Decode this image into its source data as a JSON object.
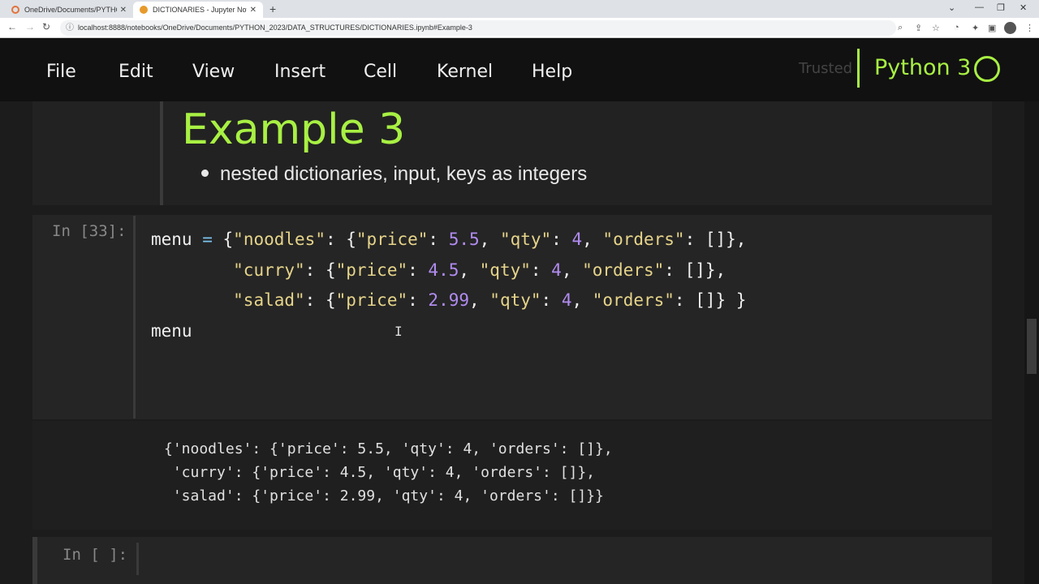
{
  "browser": {
    "tabs": [
      {
        "title": "OneDrive/Documents/PYTHON_",
        "active": false,
        "favicon_color": "#e2733a"
      },
      {
        "title": "DICTIONARIES - Jupyter Notebo",
        "active": true,
        "favicon_color": "#e79a2b"
      }
    ],
    "new_tab": "+",
    "url": "localhost:8888/notebooks/OneDrive/Documents/PYTHON_2023/DATA_STRUCTURES/DICTIONARIES.ipynb#Example-3"
  },
  "jupyter": {
    "menu": [
      "File",
      "Edit",
      "View",
      "Insert",
      "Cell",
      "Kernel",
      "Help"
    ],
    "trusted": "Trusted",
    "kernel": "Python 3",
    "accent": "#a8f043"
  },
  "markdown": {
    "heading": "Example 3",
    "bullet": "nested dictionaries, input, keys as integers"
  },
  "code_cell": {
    "prompt": "In [33]:",
    "line1": {
      "a": "menu ",
      "eq": "=",
      "b": " {",
      "s1": "\"noodles\"",
      "c": ": {",
      "s2": "\"price\"",
      "d": ": ",
      "n1": "5.5",
      "e": ", ",
      "s3": "\"qty\"",
      "f": ": ",
      "n2": "4",
      "g": ", ",
      "s4": "\"orders\"",
      "h": ": []},"
    },
    "line2": {
      "a": "        ",
      "s1": "\"curry\"",
      "c": ": {",
      "s2": "\"price\"",
      "d": ": ",
      "n1": "4.5",
      "e": ", ",
      "s3": "\"qty\"",
      "f": ": ",
      "n2": "4",
      "g": ", ",
      "s4": "\"orders\"",
      "h": ": []},"
    },
    "line3": {
      "a": "        ",
      "s1": "\"salad\"",
      "c": ": {",
      "s2": "\"price\"",
      "d": ": ",
      "n1": "2.99",
      "e": ", ",
      "s3": "\"qty\"",
      "f": ": ",
      "n2": "4",
      "g": ", ",
      "s4": "\"orders\"",
      "h": ": []} }"
    },
    "line4": "menu"
  },
  "output": {
    "lines": [
      "{'noodles': {'price': 5.5, 'qty': 4, 'orders': []},",
      " 'curry': {'price': 4.5, 'qty': 4, 'orders': []},",
      " 'salad': {'price': 2.99, 'qty': 4, 'orders': []}}"
    ]
  },
  "empty_cell": {
    "prompt": "In [ ]:"
  }
}
